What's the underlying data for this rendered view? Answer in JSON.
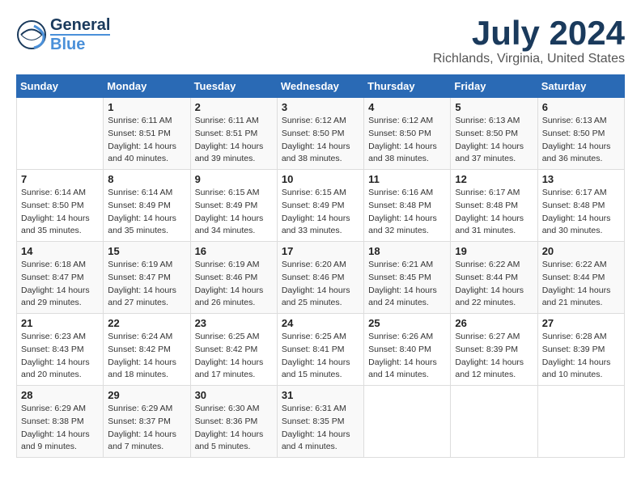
{
  "logo": {
    "line1": "General",
    "line2": "Blue"
  },
  "title": "July 2024",
  "subtitle": "Richlands, Virginia, United States",
  "weekdays": [
    "Sunday",
    "Monday",
    "Tuesday",
    "Wednesday",
    "Thursday",
    "Friday",
    "Saturday"
  ],
  "weeks": [
    [
      {
        "day": "",
        "sunrise": "",
        "sunset": "",
        "daylight": ""
      },
      {
        "day": "1",
        "sunrise": "6:11 AM",
        "sunset": "8:51 PM",
        "daylight": "14 hours and 40 minutes."
      },
      {
        "day": "2",
        "sunrise": "6:11 AM",
        "sunset": "8:51 PM",
        "daylight": "14 hours and 39 minutes."
      },
      {
        "day": "3",
        "sunrise": "6:12 AM",
        "sunset": "8:50 PM",
        "daylight": "14 hours and 38 minutes."
      },
      {
        "day": "4",
        "sunrise": "6:12 AM",
        "sunset": "8:50 PM",
        "daylight": "14 hours and 38 minutes."
      },
      {
        "day": "5",
        "sunrise": "6:13 AM",
        "sunset": "8:50 PM",
        "daylight": "14 hours and 37 minutes."
      },
      {
        "day": "6",
        "sunrise": "6:13 AM",
        "sunset": "8:50 PM",
        "daylight": "14 hours and 36 minutes."
      }
    ],
    [
      {
        "day": "7",
        "sunrise": "6:14 AM",
        "sunset": "8:50 PM",
        "daylight": "14 hours and 35 minutes."
      },
      {
        "day": "8",
        "sunrise": "6:14 AM",
        "sunset": "8:49 PM",
        "daylight": "14 hours and 35 minutes."
      },
      {
        "day": "9",
        "sunrise": "6:15 AM",
        "sunset": "8:49 PM",
        "daylight": "14 hours and 34 minutes."
      },
      {
        "day": "10",
        "sunrise": "6:15 AM",
        "sunset": "8:49 PM",
        "daylight": "14 hours and 33 minutes."
      },
      {
        "day": "11",
        "sunrise": "6:16 AM",
        "sunset": "8:48 PM",
        "daylight": "14 hours and 32 minutes."
      },
      {
        "day": "12",
        "sunrise": "6:17 AM",
        "sunset": "8:48 PM",
        "daylight": "14 hours and 31 minutes."
      },
      {
        "day": "13",
        "sunrise": "6:17 AM",
        "sunset": "8:48 PM",
        "daylight": "14 hours and 30 minutes."
      }
    ],
    [
      {
        "day": "14",
        "sunrise": "6:18 AM",
        "sunset": "8:47 PM",
        "daylight": "14 hours and 29 minutes."
      },
      {
        "day": "15",
        "sunrise": "6:19 AM",
        "sunset": "8:47 PM",
        "daylight": "14 hours and 27 minutes."
      },
      {
        "day": "16",
        "sunrise": "6:19 AM",
        "sunset": "8:46 PM",
        "daylight": "14 hours and 26 minutes."
      },
      {
        "day": "17",
        "sunrise": "6:20 AM",
        "sunset": "8:46 PM",
        "daylight": "14 hours and 25 minutes."
      },
      {
        "day": "18",
        "sunrise": "6:21 AM",
        "sunset": "8:45 PM",
        "daylight": "14 hours and 24 minutes."
      },
      {
        "day": "19",
        "sunrise": "6:22 AM",
        "sunset": "8:44 PM",
        "daylight": "14 hours and 22 minutes."
      },
      {
        "day": "20",
        "sunrise": "6:22 AM",
        "sunset": "8:44 PM",
        "daylight": "14 hours and 21 minutes."
      }
    ],
    [
      {
        "day": "21",
        "sunrise": "6:23 AM",
        "sunset": "8:43 PM",
        "daylight": "14 hours and 20 minutes."
      },
      {
        "day": "22",
        "sunrise": "6:24 AM",
        "sunset": "8:42 PM",
        "daylight": "14 hours and 18 minutes."
      },
      {
        "day": "23",
        "sunrise": "6:25 AM",
        "sunset": "8:42 PM",
        "daylight": "14 hours and 17 minutes."
      },
      {
        "day": "24",
        "sunrise": "6:25 AM",
        "sunset": "8:41 PM",
        "daylight": "14 hours and 15 minutes."
      },
      {
        "day": "25",
        "sunrise": "6:26 AM",
        "sunset": "8:40 PM",
        "daylight": "14 hours and 14 minutes."
      },
      {
        "day": "26",
        "sunrise": "6:27 AM",
        "sunset": "8:39 PM",
        "daylight": "14 hours and 12 minutes."
      },
      {
        "day": "27",
        "sunrise": "6:28 AM",
        "sunset": "8:39 PM",
        "daylight": "14 hours and 10 minutes."
      }
    ],
    [
      {
        "day": "28",
        "sunrise": "6:29 AM",
        "sunset": "8:38 PM",
        "daylight": "14 hours and 9 minutes."
      },
      {
        "day": "29",
        "sunrise": "6:29 AM",
        "sunset": "8:37 PM",
        "daylight": "14 hours and 7 minutes."
      },
      {
        "day": "30",
        "sunrise": "6:30 AM",
        "sunset": "8:36 PM",
        "daylight": "14 hours and 5 minutes."
      },
      {
        "day": "31",
        "sunrise": "6:31 AM",
        "sunset": "8:35 PM",
        "daylight": "14 hours and 4 minutes."
      },
      {
        "day": "",
        "sunrise": "",
        "sunset": "",
        "daylight": ""
      },
      {
        "day": "",
        "sunrise": "",
        "sunset": "",
        "daylight": ""
      },
      {
        "day": "",
        "sunrise": "",
        "sunset": "",
        "daylight": ""
      }
    ]
  ]
}
